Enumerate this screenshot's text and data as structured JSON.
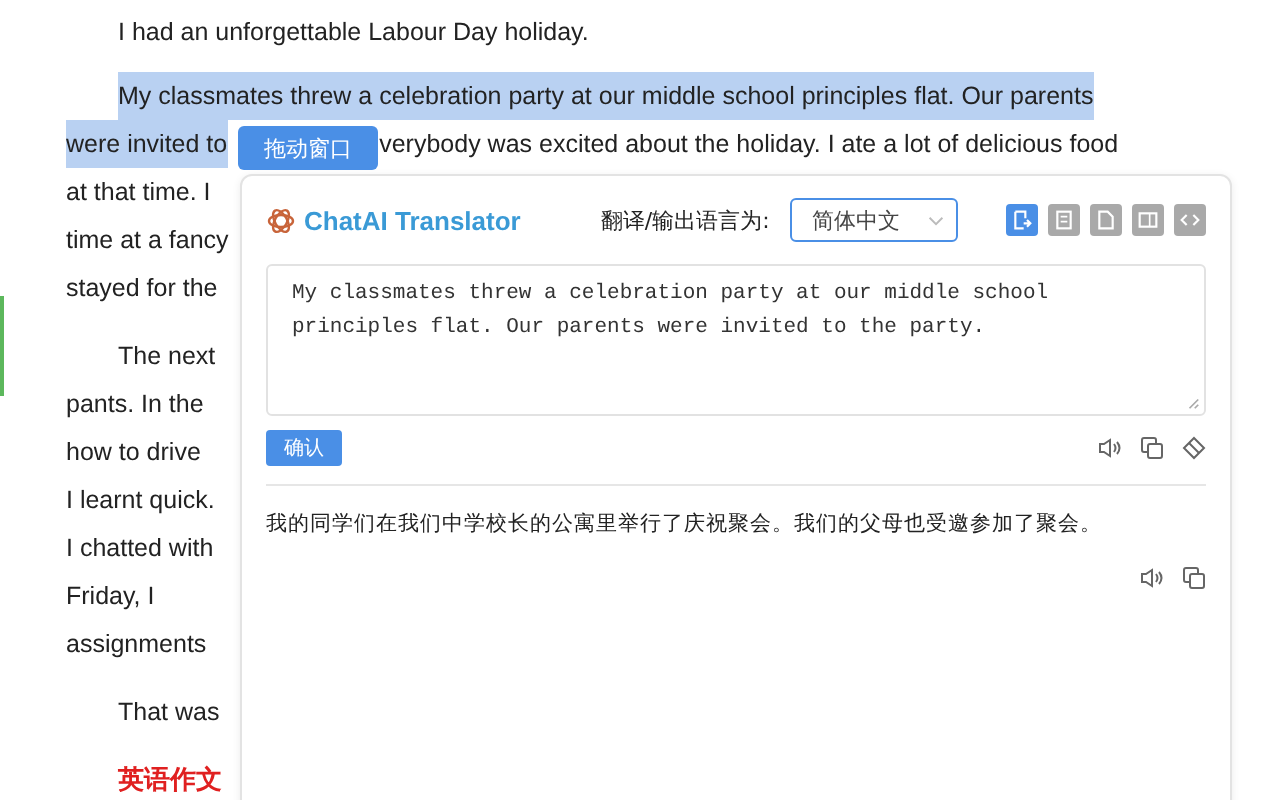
{
  "article": {
    "paragraphs": [
      {
        "kind": "text",
        "lines": [
          [
            {
              "text": "I had an unforgettable Labour Day holiday.",
              "highlighted": false
            }
          ]
        ]
      },
      {
        "kind": "text",
        "lines": [
          [
            {
              "text": "My classmates threw a celebration party at our middle school principles flat. Our parents",
              "highlighted": true
            }
          ],
          [
            {
              "text": "were invited to",
              "highlighted": true
            },
            {
              "text": "verybody was excited about the holiday. I ate a lot of delicious food",
              "highlighted": false
            }
          ],
          [
            {
              "text": "at that time. I",
              "highlighted": false
            }
          ],
          [
            {
              "text": "time at a fancy",
              "highlighted": false
            }
          ],
          [
            {
              "text": "stayed for the",
              "highlighted": false
            }
          ]
        ]
      },
      {
        "kind": "text",
        "lines": [
          [
            {
              "text": "The next",
              "highlighted": false
            }
          ],
          [
            {
              "text": "pants. In the",
              "highlighted": false
            }
          ],
          [
            {
              "text": "how to drive",
              "highlighted": false
            }
          ],
          [
            {
              "text": "I learnt quick.",
              "highlighted": false
            }
          ],
          [
            {
              "text": "I chatted with",
              "highlighted": false
            }
          ],
          [
            {
              "text": "Friday, I",
              "highlighted": false
            }
          ],
          [
            {
              "text": "assignments",
              "highlighted": false
            }
          ]
        ]
      },
      {
        "kind": "text",
        "lines": [
          [
            {
              "text": "That was",
              "highlighted": false
            }
          ]
        ]
      },
      {
        "kind": "heading",
        "lines": [
          [
            {
              "text": "英语作文",
              "highlighted": false
            }
          ]
        ]
      }
    ]
  },
  "drag_button": "拖动窗口",
  "translator": {
    "title": "ChatAI Translator",
    "language_label": "翻译/输出语言为:",
    "language": "简体中文",
    "modes": [
      {
        "kind": "input",
        "selected": true
      },
      {
        "kind": "page",
        "selected": false
      },
      {
        "kind": "file",
        "selected": false
      },
      {
        "kind": "panel",
        "selected": false
      },
      {
        "kind": "code",
        "selected": false
      }
    ],
    "source_text": "My classmates threw a celebration party at our middle school principles flat. Our parents were invited to the party.",
    "confirm_button": "确认",
    "result": "我的同学们在我们中学校长的公寓里举行了庆祝聚会。我们的父母也受邀参加了聚会。"
  }
}
